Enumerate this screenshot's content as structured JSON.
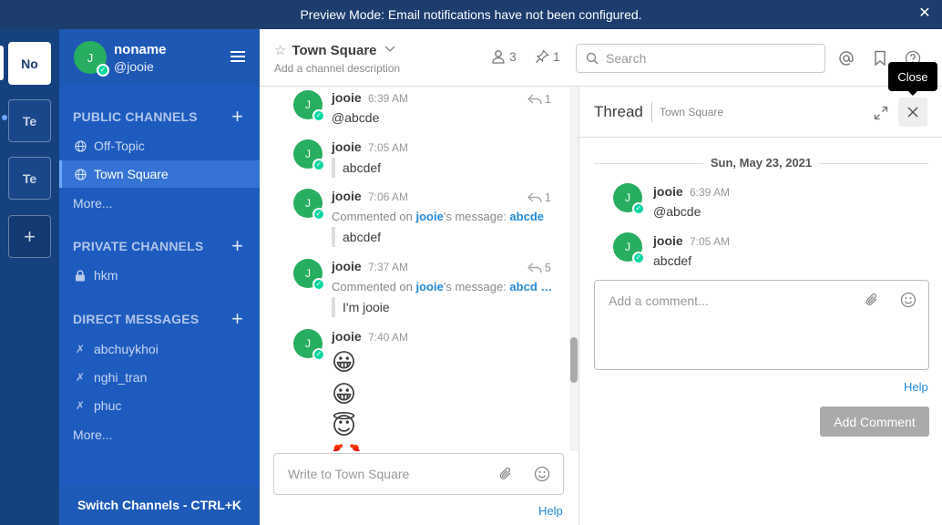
{
  "banner": {
    "text": "Preview Mode: Email notifications have not been configured."
  },
  "teams": [
    {
      "label": "No"
    },
    {
      "label": "Te"
    },
    {
      "label": "Te"
    },
    {
      "label": "+"
    }
  ],
  "sidebar": {
    "user": {
      "initial": "J",
      "name": "noname",
      "handle": "@jooie"
    },
    "public_title": "PUBLIC CHANNELS",
    "public_channels": [
      {
        "label": "Off-Topic"
      },
      {
        "label": "Town Square"
      }
    ],
    "public_more": "More...",
    "private_title": "PRIVATE CHANNELS",
    "private_channels": [
      {
        "label": "hkm"
      }
    ],
    "dm_title": "DIRECT MESSAGES",
    "dms": [
      {
        "label": "abchuykhoi"
      },
      {
        "label": "nghi_tran"
      },
      {
        "label": "phuc"
      }
    ],
    "dm_more": "More...",
    "switch_channels": "Switch Channels - CTRL+K"
  },
  "header": {
    "channel_name": "Town Square",
    "description": "Add a channel description",
    "members": "3",
    "pinned": "1",
    "search_placeholder": "Search"
  },
  "posts": [
    {
      "initial": "J",
      "author": "jooie",
      "time": "6:39 AM",
      "text": "@abcde",
      "replies": "1"
    },
    {
      "initial": "J",
      "author": "jooie",
      "time": "7:05 AM",
      "quote": "abcdef"
    },
    {
      "initial": "J",
      "author": "jooie",
      "time": "7:06 AM",
      "commented_prefix": "Commented on ",
      "commented_user": "jooie",
      "commented_mid": "'s message: ",
      "commented_msg": "abcde",
      "quote": "abcdef",
      "replies": "1"
    },
    {
      "initial": "J",
      "author": "jooie",
      "time": "7:37 AM",
      "commented_prefix": "Commented on ",
      "commented_user": "jooie",
      "commented_mid": "'s message: ",
      "commented_msg": "abcd …",
      "quote": "I'm jooie",
      "replies": "5"
    },
    {
      "initial": "J",
      "author": "jooie",
      "time": "7:40 AM",
      "emojis": [
        "😀",
        "😀",
        "😇",
        "🤡"
      ]
    }
  ],
  "composer": {
    "placeholder": "Write to Town Square",
    "help": "Help"
  },
  "thread": {
    "title": "Thread",
    "channel": "Town Square",
    "close_tooltip": "Close",
    "date": "Sun, May 23, 2021",
    "posts": [
      {
        "initial": "J",
        "author": "jooie",
        "time": "6:39 AM",
        "text": "@abcde"
      },
      {
        "initial": "J",
        "author": "jooie",
        "time": "7:05 AM",
        "text": "abcdef"
      }
    ],
    "comment_placeholder": "Add a comment...",
    "help": "Help",
    "add_comment": "Add Comment"
  },
  "colors": {
    "banner": "#1c3d6e",
    "team_sidebar": "#15427f",
    "channel_sidebar": "#1d5bbf",
    "avatar": "#27ae60",
    "link": "#2389d7"
  }
}
